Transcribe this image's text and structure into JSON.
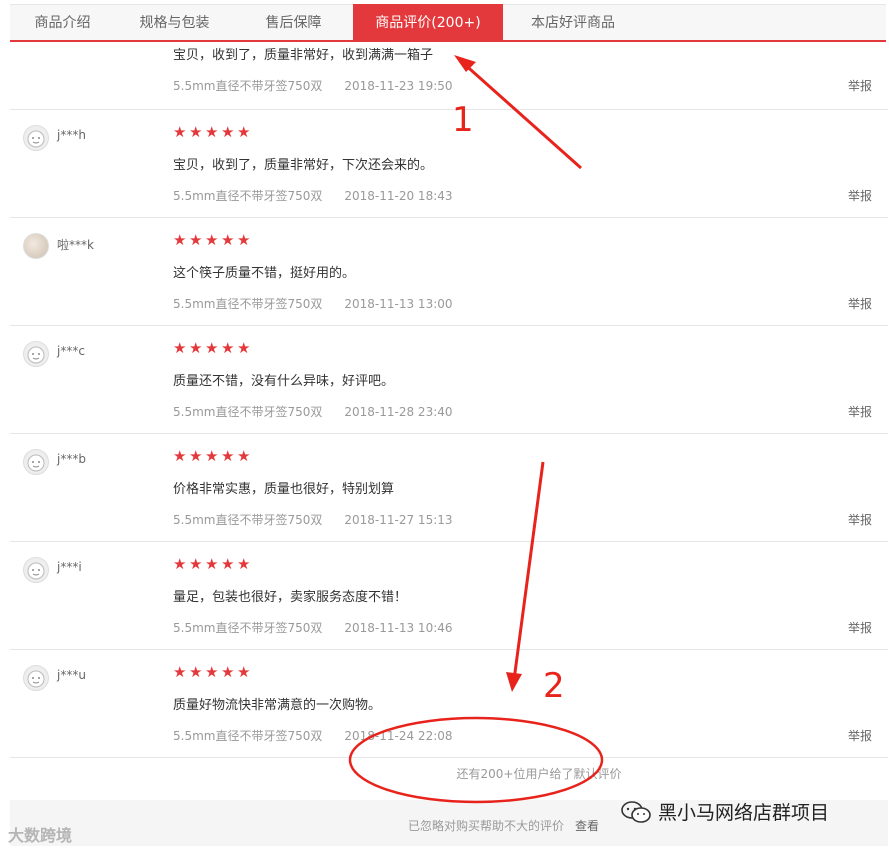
{
  "tabs": [
    {
      "label": "商品介绍"
    },
    {
      "label": "规格与包装"
    },
    {
      "label": "售后保障"
    },
    {
      "label": "商品评价(200+)"
    },
    {
      "label": "本店好评商品"
    }
  ],
  "first_review": {
    "content": "宝贝，收到了，质量非常好，收到满满一箱子",
    "spec": "5.5mm直径不带牙签750双",
    "date": "2018-11-23 19:50",
    "report": "举报"
  },
  "reviews": [
    {
      "user": "j***h",
      "rating": 5,
      "content": "宝贝，收到了，质量非常好，下次还会来的。",
      "spec": "5.5mm直径不带牙签750双",
      "date": "2018-11-20 18:43",
      "report": "举报"
    },
    {
      "user": "啦***k",
      "rating": 5,
      "content": "这个筷子质量不错，挺好用的。",
      "spec": "5.5mm直径不带牙签750双",
      "date": "2018-11-13 13:00",
      "report": "举报"
    },
    {
      "user": "j***c",
      "rating": 5,
      "content": "质量还不错，没有什么异味，好评吧。",
      "spec": "5.5mm直径不带牙签750双",
      "date": "2018-11-28 23:40",
      "report": "举报"
    },
    {
      "user": "j***b",
      "rating": 5,
      "content": "价格非常实惠，质量也很好，特别划算",
      "spec": "5.5mm直径不带牙签750双",
      "date": "2018-11-27 15:13",
      "report": "举报"
    },
    {
      "user": "j***i",
      "rating": 5,
      "content": "量足，包装也很好，卖家服务态度不错！",
      "spec": "5.5mm直径不带牙签750双",
      "date": "2018-11-13 10:46",
      "report": "举报"
    },
    {
      "user": "j***u",
      "rating": 5,
      "content": "质量好物流快非常满意的一次购物。",
      "spec": "5.5mm直径不带牙签750双",
      "date": "2018-11-24 22:08",
      "report": "举报"
    }
  ],
  "more_text": "还有200+位用户给了默认评价",
  "footer": {
    "text": "已忽略对购买帮助不大的评价",
    "link": "查看"
  },
  "watermark_left": "大数跨境",
  "watermark_right": "黑小马网络店群项目",
  "annotations": [
    "1",
    "2"
  ],
  "colors": {
    "accent": "#e4393c",
    "annotation": "#e8231c"
  }
}
